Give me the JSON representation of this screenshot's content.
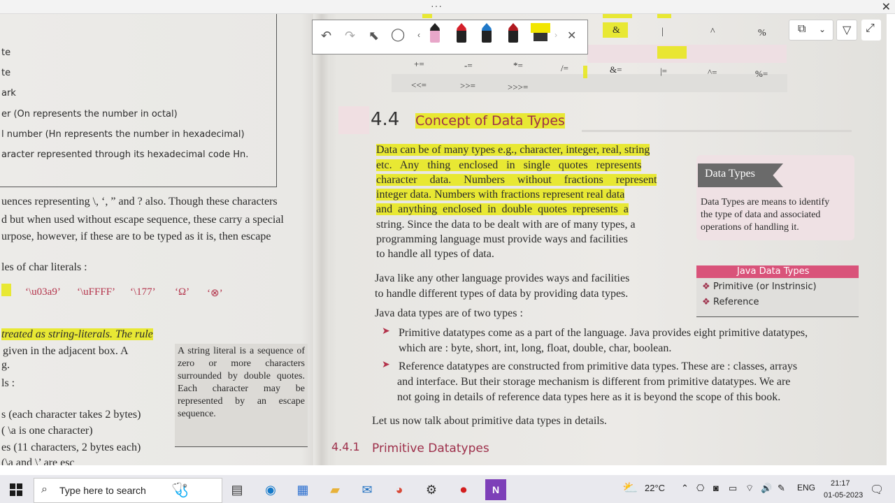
{
  "window": {
    "handle_dots": "···",
    "close": "✕"
  },
  "toolbar": {
    "icons": [
      "undo-icon",
      "redo-icon",
      "select-icon",
      "lasso-icon",
      "chevron-left-icon",
      "pen-pink-icon",
      "pen-red-icon",
      "pen-blue-icon",
      "pen-darkred-icon",
      "highlighter-yellow-icon",
      "chevron-right-icon",
      "close-icon"
    ],
    "pen_colors": {
      "pink": "#e8a6c9",
      "red": "#d4202a",
      "blue": "#1f78c8",
      "darkred": "#b0181e",
      "yellow": "#f2e600"
    }
  },
  "right_tools": {
    "icons": [
      "copy-page-icon",
      "chevron-down-icon",
      "filter-icon",
      "expand-icon"
    ]
  },
  "left_page": {
    "lines": [
      "te",
      "te",
      "ark",
      "er (On represents the number in octal)",
      "l number (Hn represents the number in hexadecimal)",
      "aracter represented through its hexadecimal code Hn.",
      "uences representing \\, ‘, ” and ? also. Though these characters",
      "d but when used without escape sequence, these carry a special",
      "urpose, however, if these are to be typed as it is, then escape",
      "les of char literals :",
      "treated as string-literals. The rule",
      "given in the adjacent box. A",
      "g.",
      "ls :",
      "s (each character takes 2 bytes)",
      "( \\a is one character)",
      "es (11 characters, 2 bytes each)",
      "(\\a and \\’ are esc"
    ],
    "char_literals": [
      "‘\\u03a9’",
      "‘\\uFFFF’",
      "‘\\177’",
      "‘Ω’",
      "‘⊗’"
    ],
    "sidenote": "A string literal is a sequence of zero or more characters surrounded by double quotes. Each character may be represented by an escape sequence."
  },
  "operators": {
    "row1": [
      "&",
      "|",
      "^",
      "%"
    ],
    "row2": [
      "+=",
      "-=",
      "*=",
      "/=",
      "&=",
      "|=",
      "^=",
      "%="
    ],
    "row3": [
      "<<=",
      ">>=",
      ">>>="
    ]
  },
  "section": {
    "number": "4.4",
    "title": "Concept of Data Types",
    "para1": [
      "Data can be of many types e.g., character, integer, real, string",
      "etc. Any thing enclosed in single quotes represents",
      "character data. Numbers without fractions represent",
      "integer data. Numbers with fractions represent real data",
      "and anything enclosed in double quotes represents a",
      "string. Since the data to be dealt with are of many types, a",
      "programming language must provide ways and facilities",
      "to handle all types of data."
    ],
    "para2": [
      "Java like any other language provides ways and facilities",
      "to handle different types of data by providing data types."
    ],
    "para3": "Java data types are of two types :",
    "bullet1": [
      "Primitive datatypes come as a part of the language. Java provides eight primitive datatypes,",
      "which are : byte, short, int, long, float, double, char, boolean."
    ],
    "bullet2": [
      "Reference datatypes are constructed from primitive data types. These are : classes, arrays",
      "and interface. But their storage mechanism is different from primitive datatypes. We are",
      "not going in details of reference data types here as it is beyond the scope of this book."
    ],
    "para4": "Let us now talk about primitive data types in details.",
    "sub_number": "4.4.1",
    "sub_title": "Primitive Datatypes"
  },
  "data_types_box": {
    "title": "Data Types",
    "body": [
      "Data Types are means to identify",
      "the type of data and associated",
      "operations of handling it."
    ]
  },
  "java_types_box": {
    "title": "Java Data Types",
    "items": [
      "Primitive (or Instrinsic)",
      "Reference"
    ]
  },
  "taskbar": {
    "search_placeholder": "Type here to search",
    "temperature": "22°C",
    "language": "ENG",
    "time": "21:17",
    "date": "01-05-2023",
    "apps": [
      "task-view-icon",
      "edge-icon",
      "store-icon",
      "file-explorer-icon",
      "mail-icon",
      "chrome-icon",
      "settings-icon",
      "record-icon",
      "onenote-icon"
    ]
  }
}
